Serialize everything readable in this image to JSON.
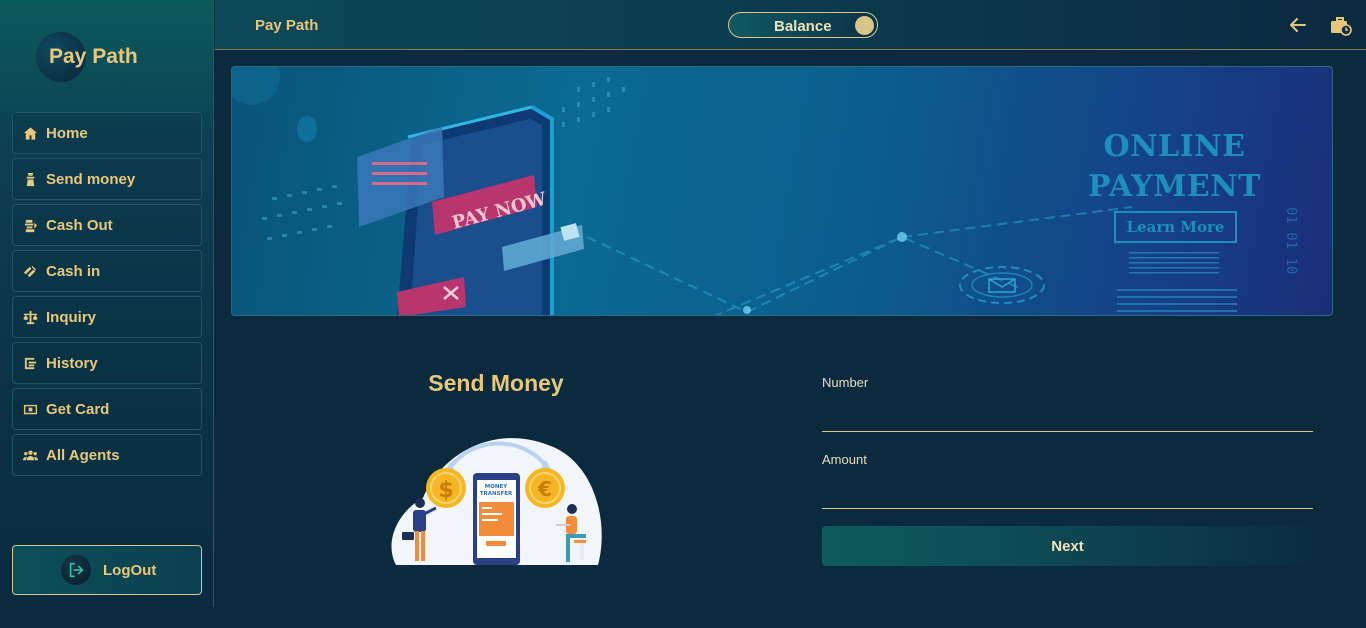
{
  "app": {
    "logo_text": "Pay Path"
  },
  "sidebar": {
    "items": [
      {
        "label": "Home",
        "icon": "home-icon"
      },
      {
        "label": "Send money",
        "icon": "send-money-icon"
      },
      {
        "label": "Cash Out",
        "icon": "cash-out-icon"
      },
      {
        "label": "Cash in",
        "icon": "cash-in-icon"
      },
      {
        "label": "Inquiry",
        "icon": "scale-icon"
      },
      {
        "label": "History",
        "icon": "history-icon"
      },
      {
        "label": "Get Card",
        "icon": "card-icon"
      },
      {
        "label": "All Agents",
        "icon": "users-icon"
      }
    ],
    "logout_label": "LogOut"
  },
  "header": {
    "title": "Pay Path",
    "balance_label": "Balance",
    "back_icon": "arrow-left-icon",
    "wallet_icon": "briefcase-clock-icon"
  },
  "banner": {
    "headline": "ONLINE PAYMENT",
    "button_label": "Learn More",
    "phone_badge": "PAY NOW"
  },
  "main": {
    "title": "Send Money",
    "illustration_caption": "MONEY TRANSFER",
    "form": {
      "number_label": "Number",
      "number_value": "",
      "amount_label": "Amount",
      "amount_value": "",
      "next_label": "Next"
    }
  },
  "colors": {
    "accent_gold": "#e8c77a",
    "sidebar_teal": "#0b5a5c",
    "background_navy": "#0b2a3e",
    "banner_blue": "#0b6a92"
  }
}
